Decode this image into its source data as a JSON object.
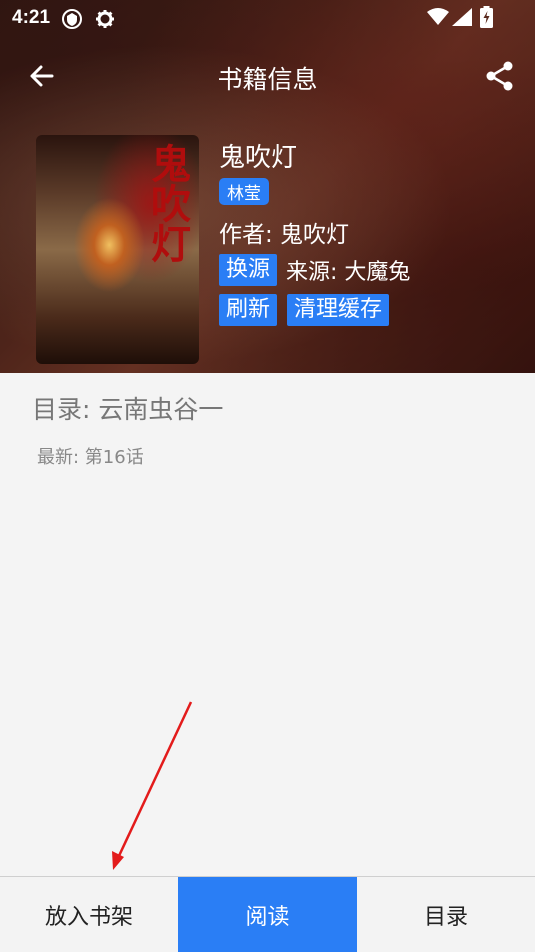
{
  "status_bar": {
    "time": "4:21"
  },
  "app_bar": {
    "title": "书籍信息"
  },
  "book": {
    "cover_title": "鬼吹灯",
    "name": "鬼吹灯",
    "tag": "林莹",
    "author": "作者: 鬼吹灯",
    "source_button": "换源",
    "source": "来源: 大魔兔",
    "refresh_button": "刷新",
    "clear_cache_button": "清理缓存"
  },
  "content": {
    "toc": "目录: 云南虫谷一",
    "latest": "最新: 第16话"
  },
  "bottom_bar": {
    "add_to_shelf": "放入书架",
    "read": "阅读",
    "catalog": "目录"
  },
  "colors": {
    "accent": "#2a7ef5",
    "annotation_arrow": "#e31b1b"
  }
}
